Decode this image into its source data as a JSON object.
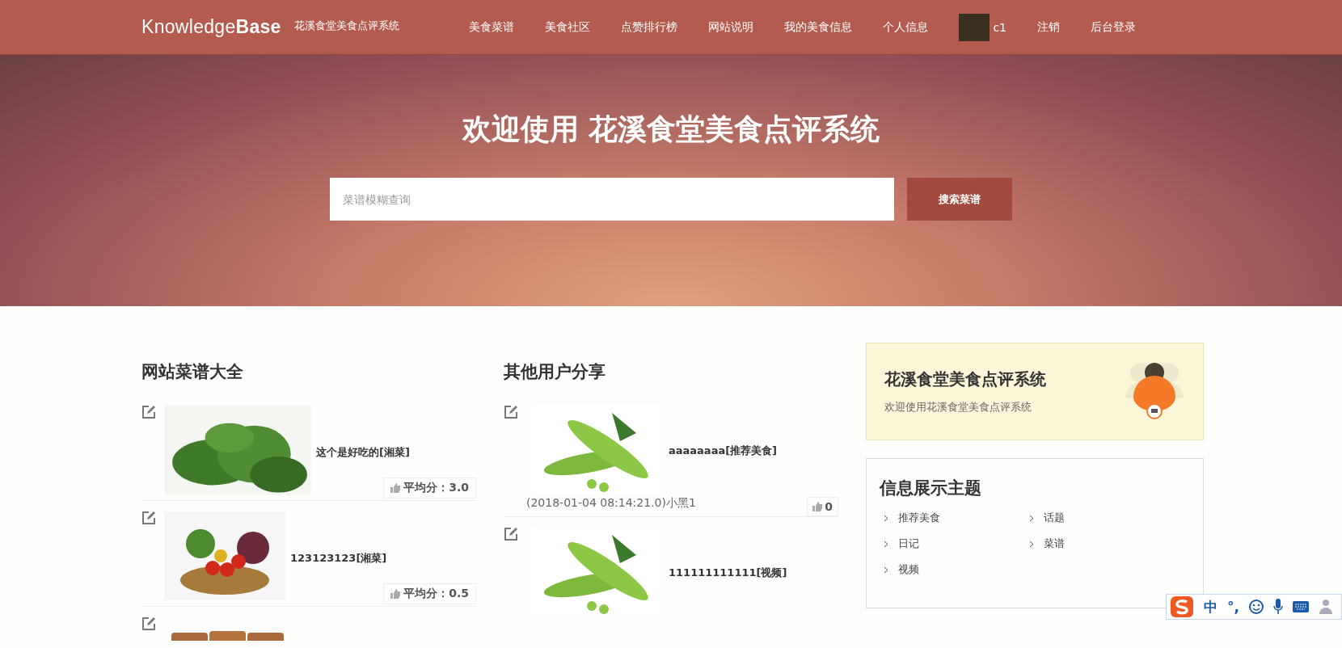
{
  "header": {
    "logo_light": "Knowledge",
    "logo_bold": "Base",
    "subtitle": "花溪食堂美食点评系统",
    "nav": [
      {
        "label": "美食菜谱"
      },
      {
        "label": "美食社区"
      },
      {
        "label": "点赞排行榜"
      },
      {
        "label": "网站说明"
      },
      {
        "label": "我的美食信息"
      },
      {
        "label": "个人信息"
      },
      {
        "label": "c1",
        "kind": "user"
      },
      {
        "label": "注销"
      },
      {
        "label": "后台登录"
      }
    ]
  },
  "hero": {
    "title": "欢迎使用 花溪食堂美食点评系统",
    "search": {
      "placeholder": "菜谱模糊查询"
    },
    "search_button": "搜索菜谱"
  },
  "recipes": {
    "title": "网站菜谱大全",
    "items": [
      {
        "kind": "full",
        "name": "这个是好吃的[湘菜]",
        "score": "平均分：3.0"
      },
      {
        "kind": "full",
        "name": "123123123[湘菜]",
        "score": "平均分：0.5"
      },
      {
        "kind": "cut"
      }
    ]
  },
  "shares": {
    "title": "其他用户分享",
    "items": [
      {
        "kind": "full",
        "name": "aaaaaaaa[推荐美食]",
        "meta": "(2018-01-04 08:14:21.0)小黑1",
        "likes": "0"
      },
      {
        "kind": "cut",
        "name": "111111111111[视频]"
      }
    ]
  },
  "intro_card": {
    "title": "花溪食堂美食点评系统",
    "text": "欢迎使用花溪食堂美食点评系统"
  },
  "topics": {
    "title": "信息展示主题",
    "items": [
      {
        "label": "推荐美食"
      },
      {
        "label": "话题"
      },
      {
        "label": "日记"
      },
      {
        "label": "菜谱"
      },
      {
        "label": "视频"
      }
    ]
  },
  "ime_bar": {
    "mode": "中",
    "punct": "°,"
  }
}
